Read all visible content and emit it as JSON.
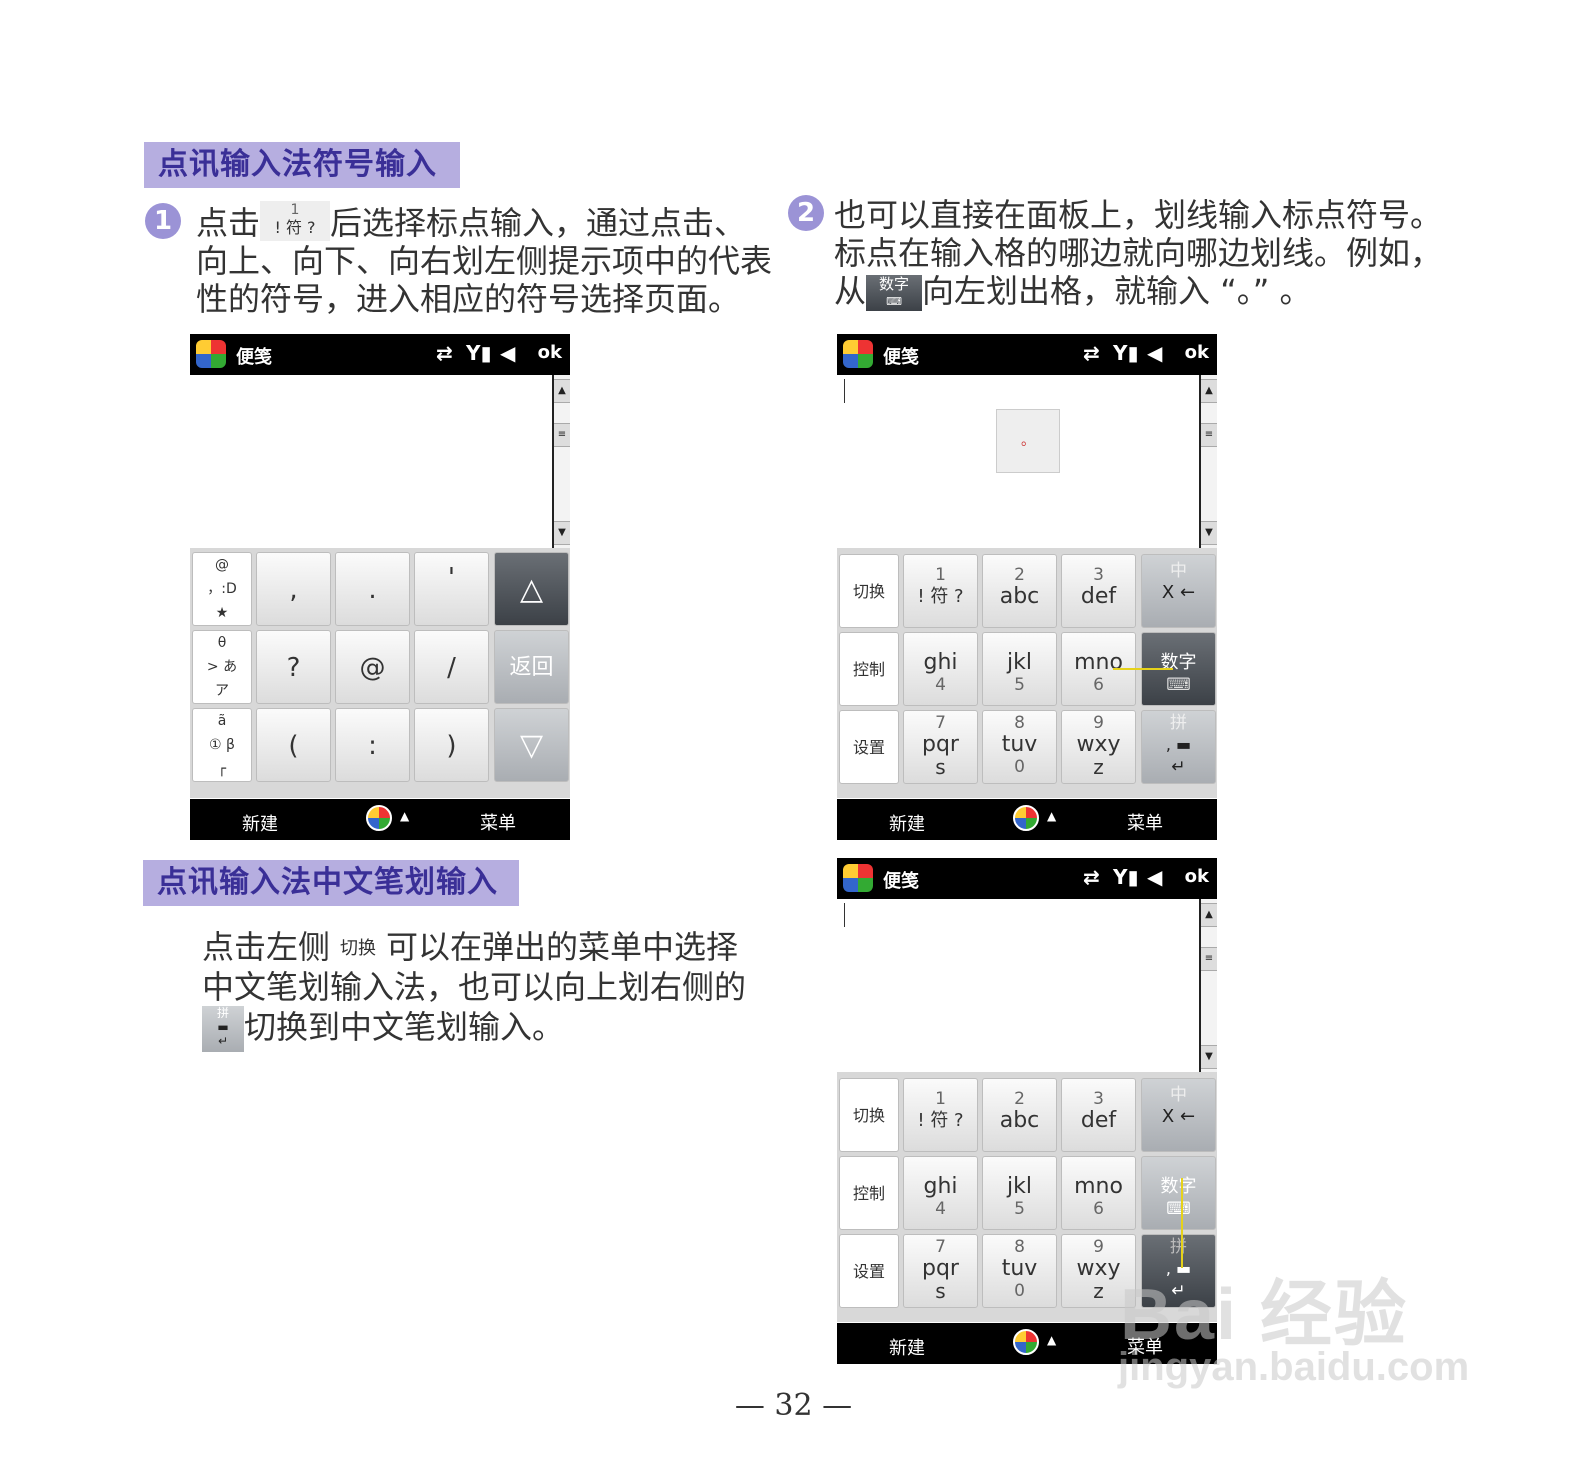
{
  "section1": {
    "title": "点讯输入法符号输入",
    "step1": {
      "num": "1",
      "pre": "点击",
      "icon_top": "1",
      "icon_mid": "! 符 ?",
      "text_after": "后选择标点输入，通过点击、",
      "line2": "向上、向下、向右划左侧提示项中的代表",
      "line3": "性的符号，进入相应的符号选择页面。"
    },
    "step2": {
      "num": "2",
      "line1": "也可以直接在面板上，划线输入标点符号。",
      "line2": "标点在输入格的哪边就向哪边划线。例如，",
      "line3_pre": "从",
      "icon_label": "数字",
      "line3_post": "向左划出格，就输入 “。” 。"
    }
  },
  "section2": {
    "title": "点讯输入法中文笔划输入",
    "line1_pre": "点击左侧",
    "icon_label": "切换",
    "line1_post": "可以在弹出的菜单中选择",
    "line2": "中文笔划输入法，也可以向上划右侧的",
    "icon2_top": "拼",
    "line3": "切换到中文笔划输入。"
  },
  "phone": {
    "title": "便笺",
    "ok": "ok",
    "left_soft": "新建",
    "right_soft": "菜单",
    "status_icons": [
      "sync-icon",
      "signal-icon",
      "speaker-icon"
    ]
  },
  "symbol_panel": {
    "hint_rows": [
      [
        "@",
        "，:D",
        "★"
      ],
      [
        "θ",
        "> あ",
        "ア"
      ],
      [
        "ã",
        "① β",
        "┌"
      ]
    ],
    "keys": [
      [
        ",",
        ".",
        "'"
      ],
      [
        "?",
        "@",
        "/"
      ],
      [
        "(",
        ":",
        ")"
      ]
    ],
    "up": "△",
    "back": "返回",
    "down": "▽"
  },
  "t9": {
    "left": [
      "切换",
      "控制",
      "设置"
    ],
    "rows": [
      [
        {
          "top": "1",
          "main": "! 符 ?"
        },
        {
          "top": "2",
          "main": "abc"
        },
        {
          "top": "3",
          "main": "def"
        }
      ],
      [
        {
          "main": "ghi",
          "bot": "4"
        },
        {
          "main": "jkl",
          "bot": "5"
        },
        {
          "main": "mno",
          "bot": "6"
        }
      ],
      [
        {
          "top": "7",
          "main": "pqr",
          "bot": "s"
        },
        {
          "top": "8",
          "main": "tuv",
          "bot": "0"
        },
        {
          "top": "9",
          "main": "wxy",
          "bot": "z"
        }
      ]
    ],
    "right": [
      {
        "top": "中",
        "main": "X ←"
      },
      {
        "main": "数字",
        "bot": "⌨"
      },
      {
        "top": "拼",
        "main": ", ▬",
        "bot": "↵"
      }
    ]
  },
  "popup_char": "。",
  "page_number": "— 32 —",
  "watermark": {
    "brand": "Bai 经验",
    "url": "jingyan.baidu.com"
  }
}
